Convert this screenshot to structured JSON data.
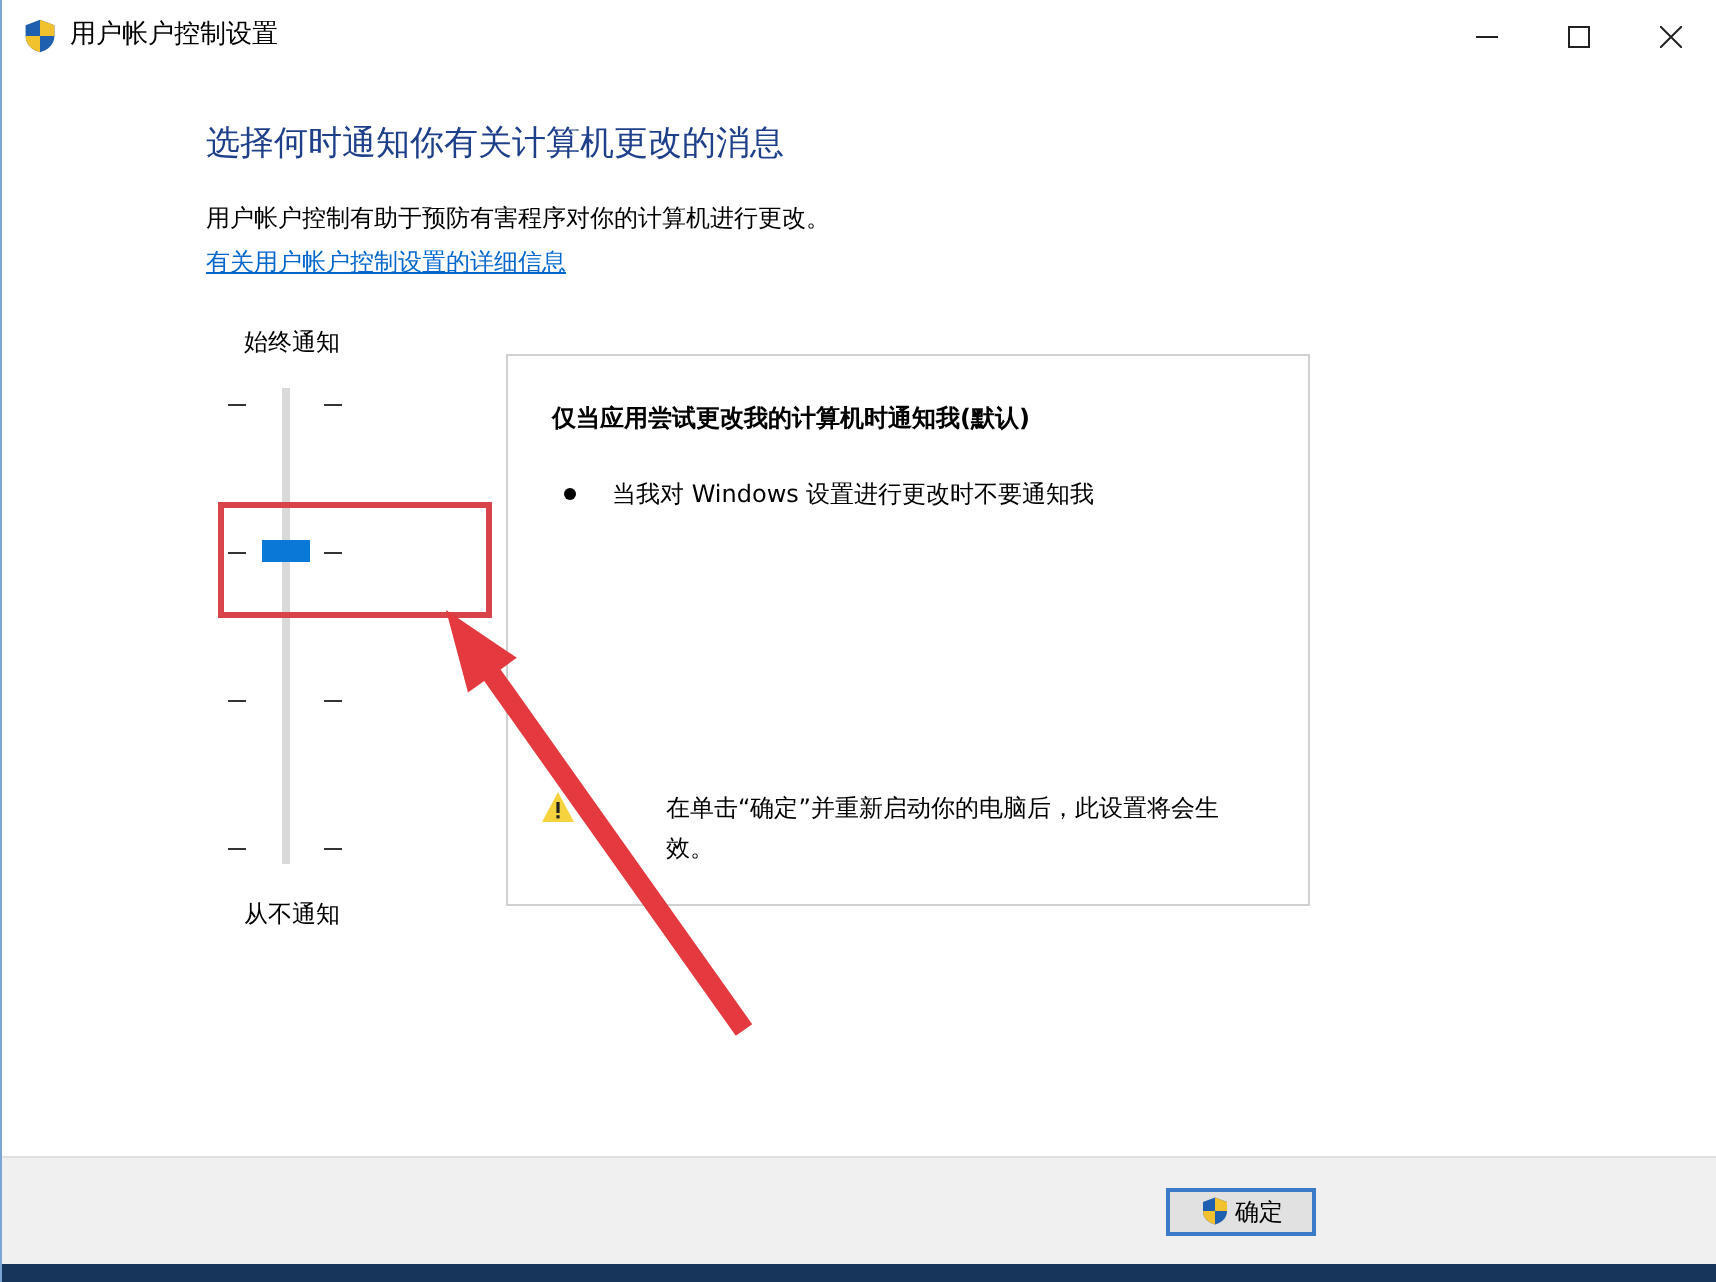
{
  "window": {
    "title": "用户帐户控制设置"
  },
  "heading": "选择何时通知你有关计算机更改的消息",
  "description": "用户帐户控制有助于预防有害程序对你的计算机进行更改。",
  "link": "有关用户帐户控制设置的详细信息",
  "slider": {
    "top_label": "始终通知",
    "bottom_label": "从不通知",
    "level": 0.667
  },
  "info_panel": {
    "title": "仅当应用尝试更改我的计算机时通知我(默认)",
    "bullets": [
      "当我对 Windows 设置进行更改时不要通知我"
    ],
    "warning": "在单击“确定”并重新启动你的电脑后，此设置将会生效。"
  },
  "buttons": [
    {
      "label": "确定",
      "kind": "shield"
    }
  ]
}
